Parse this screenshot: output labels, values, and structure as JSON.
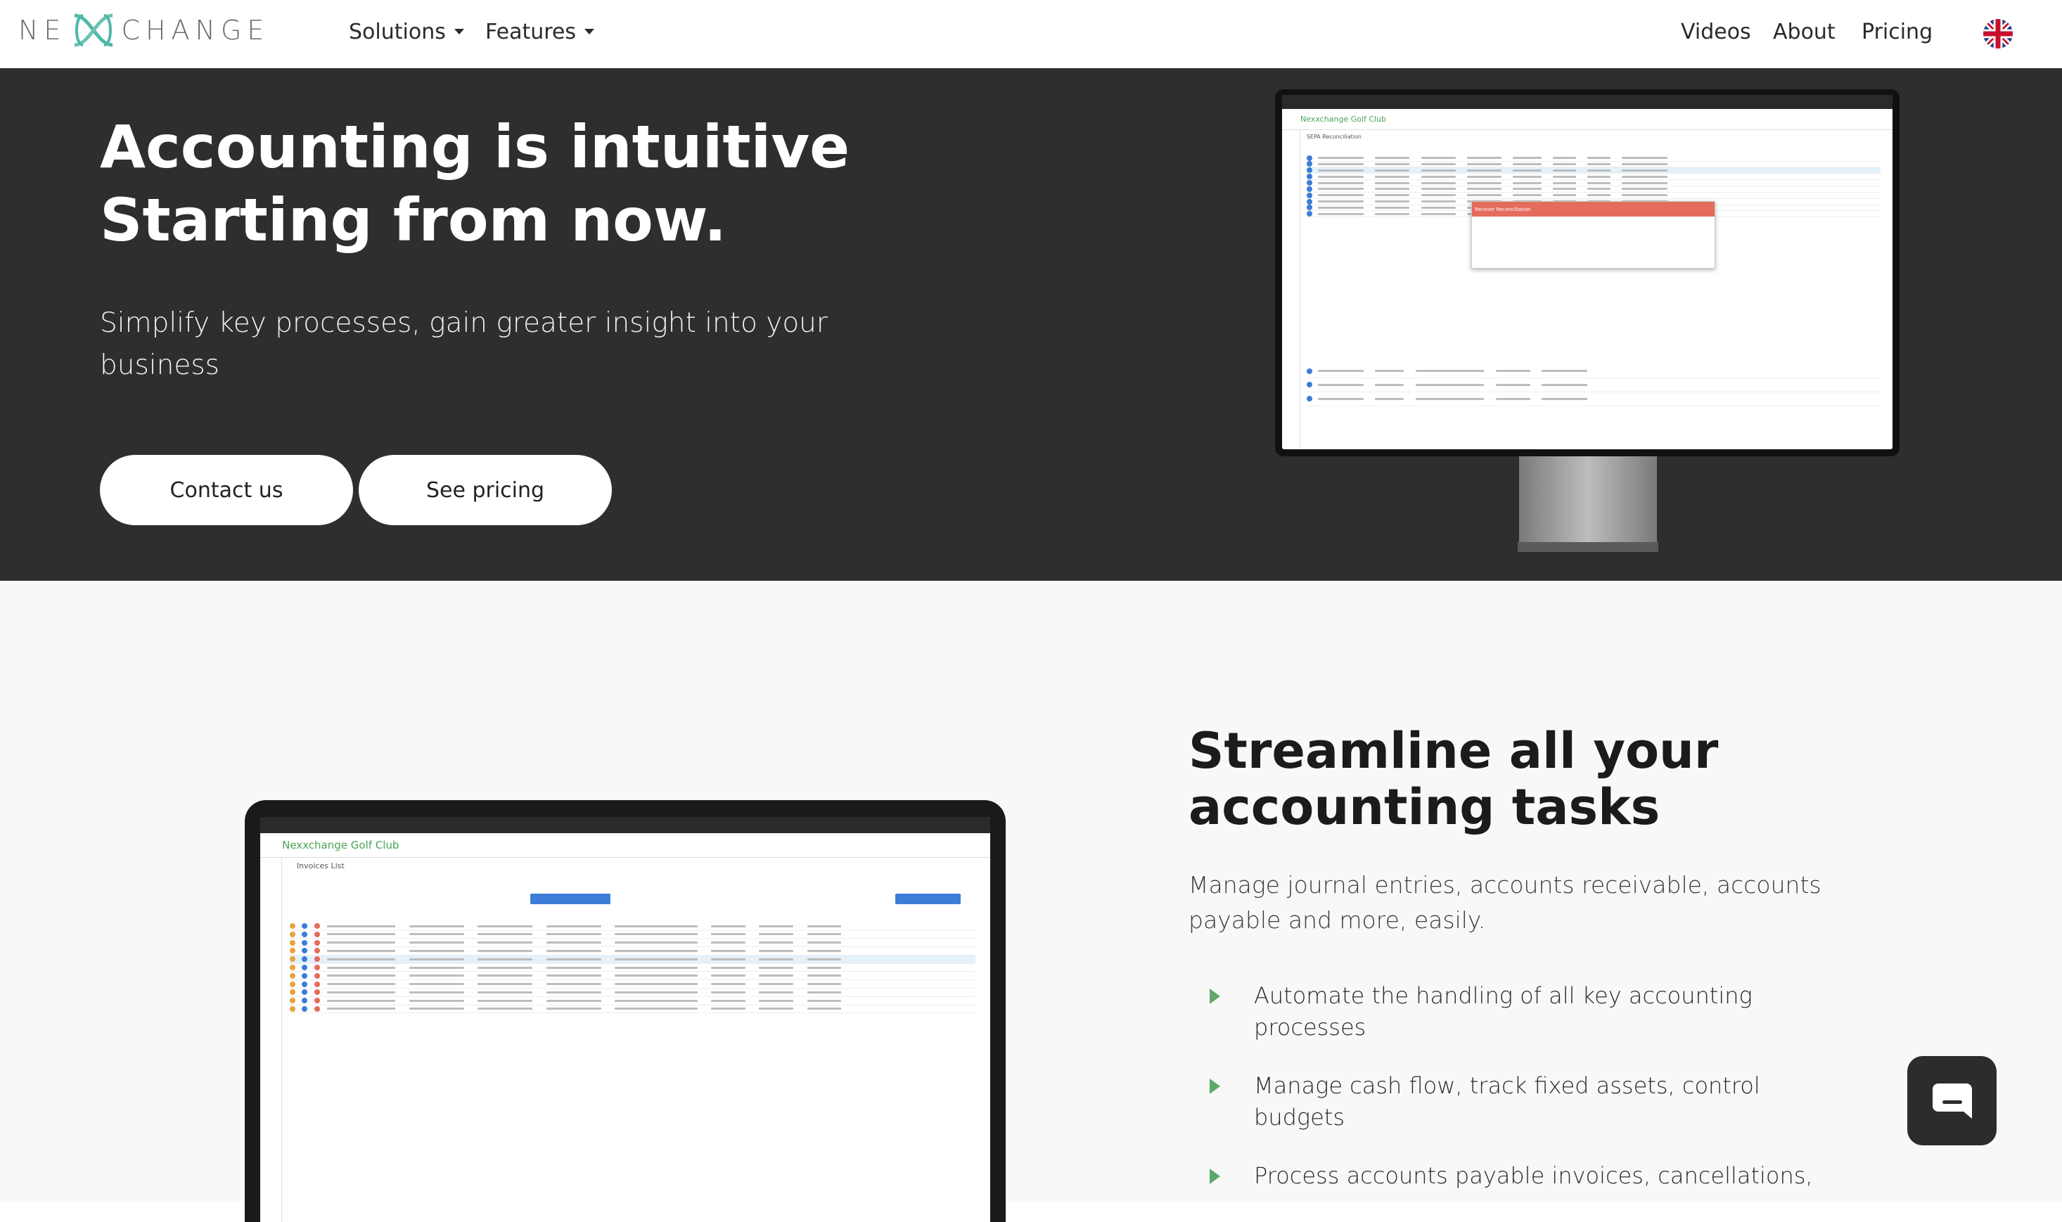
{
  "nav": {
    "logo_left": "NE",
    "logo_right": "CHANGE",
    "solutions": "Solutions",
    "features": "Features",
    "videos": "Videos",
    "about": "About",
    "pricing": "Pricing",
    "language_icon": "uk-flag-icon"
  },
  "hero": {
    "title_line1": "Accounting is intuitive",
    "title_line2": "Starting from now.",
    "subtitle": "Simplify key processes, gain greater insight into your business",
    "contact_button": "Contact us",
    "pricing_button": "See pricing",
    "app_name": "Nexxchange Golf Club",
    "screen_section": "SEPA Reconciliation",
    "dialog_title": "Recover Reconciliation"
  },
  "section2": {
    "title": "Streamline all your accounting tasks",
    "description": "Manage journal entries, accounts receivable, accounts payable and more, easily.",
    "features": [
      "Automate the handling of all key accounting processes",
      "Manage cash flow, track fixed assets, control budgets",
      "Process accounts payable invoices, cancellations,"
    ],
    "app_name": "Nexxchange Golf Club",
    "screen_section": "Invoices List"
  },
  "colors": {
    "hero_bg": "#2f2d2d",
    "accent_green": "#5fa86a",
    "logo_teal": "#4fb8a8"
  },
  "chat_icon": "chat-bubble-icon"
}
